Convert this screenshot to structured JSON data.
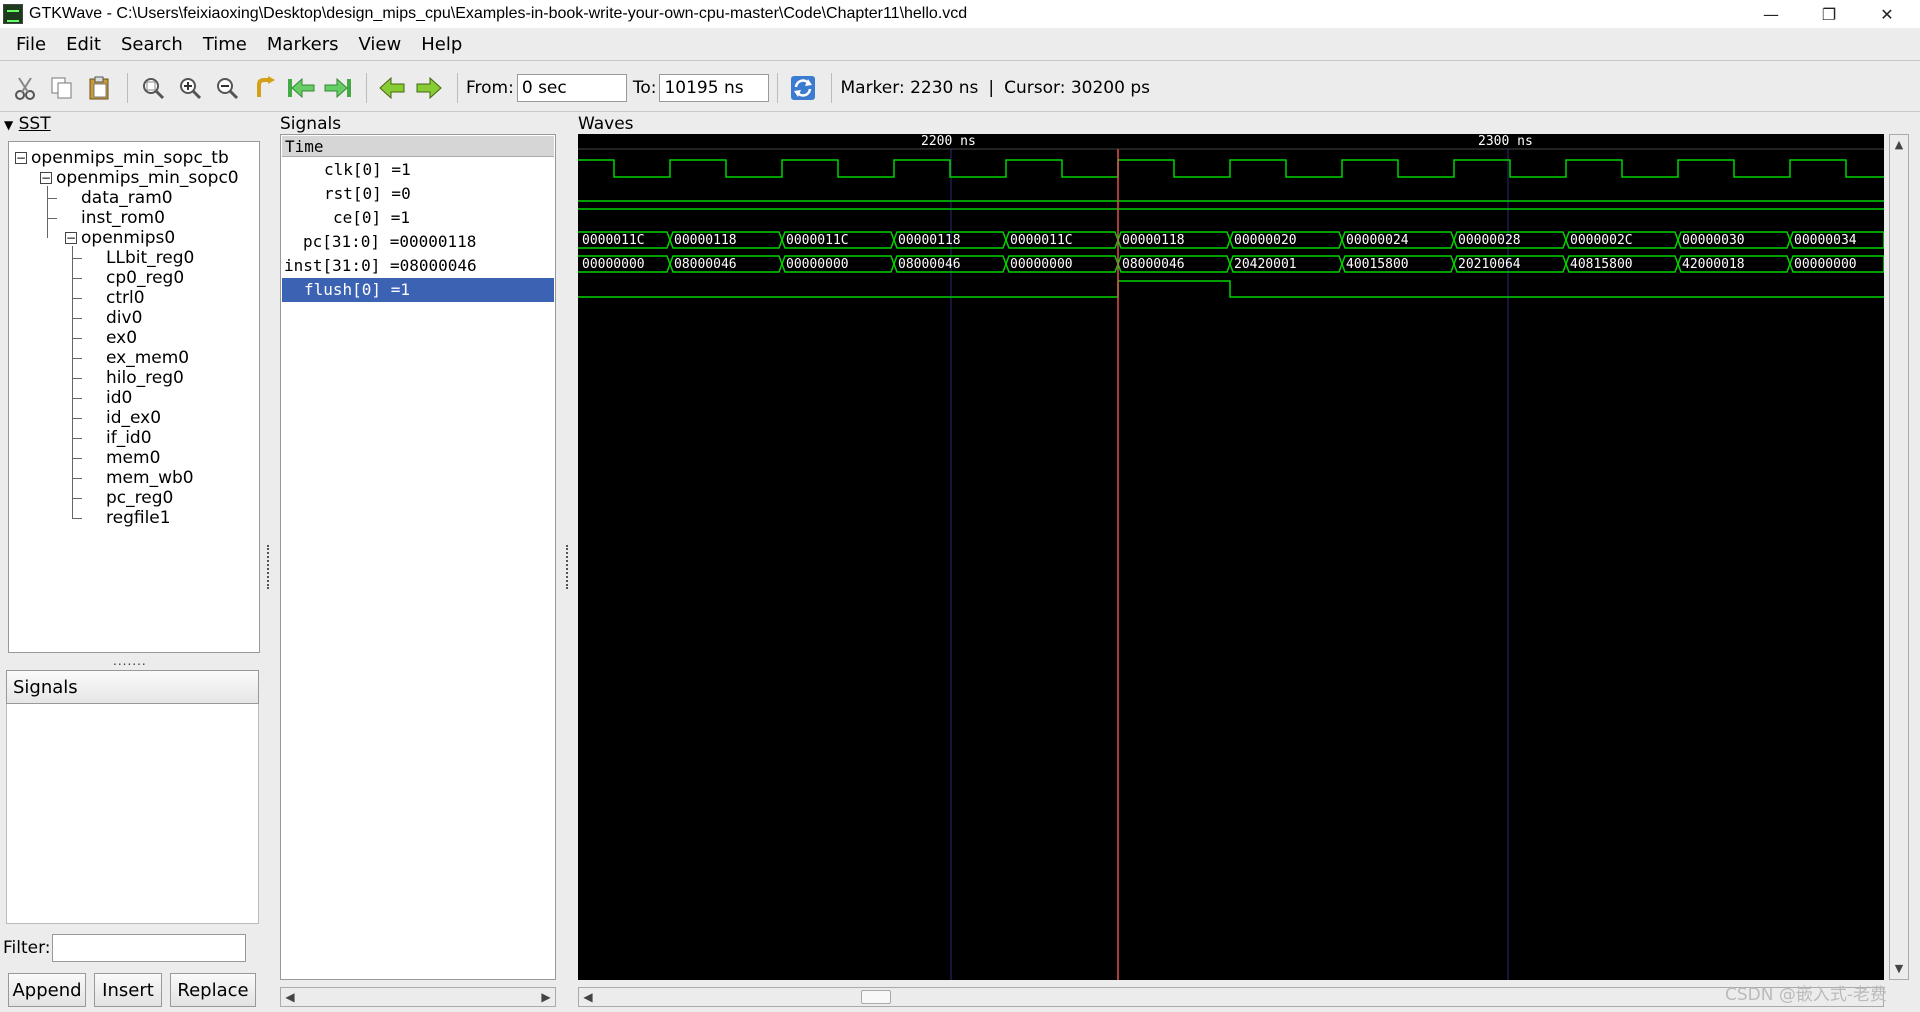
{
  "window": {
    "title": "GTKWave - C:\\Users\\feixiaoxing\\Desktop\\design_mips_cpu\\Examples-in-book-write-your-own-cpu-master\\Code\\Chapter11\\hello.vcd",
    "minimize_glyph": "—",
    "restore_glyph": "❐",
    "close_glyph": "✕"
  },
  "menu": [
    "File",
    "Edit",
    "Search",
    "Time",
    "Markers",
    "View",
    "Help"
  ],
  "toolbar": {
    "icons": [
      "cut-icon",
      "copy-icon",
      "paste-icon",
      "zoom-fit-icon",
      "zoom-in-icon",
      "zoom-out-icon",
      "zoom-undo-icon",
      "jump-start-icon",
      "jump-end-icon",
      "prev-edge-icon",
      "next-edge-icon",
      "reload-icon"
    ],
    "from_label": "From:",
    "from_value": "0 sec",
    "to_label": "To:",
    "to_value": "10195 ns",
    "marker_text": "Marker: 2230 ns",
    "separator": "|",
    "cursor_text": "Cursor: 30200 ps"
  },
  "sst": {
    "title": "SST",
    "tree": [
      {
        "label": "openmips_min_sopc_tb",
        "level": 0,
        "expanded": true
      },
      {
        "label": "openmips_min_sopc0",
        "level": 1,
        "expanded": true
      },
      {
        "label": "data_ram0",
        "level": 2
      },
      {
        "label": "inst_rom0",
        "level": 2
      },
      {
        "label": "openmips0",
        "level": 2,
        "expanded": true
      },
      {
        "label": "LLbit_reg0",
        "level": 3
      },
      {
        "label": "cp0_reg0",
        "level": 3
      },
      {
        "label": "ctrl0",
        "level": 3
      },
      {
        "label": "div0",
        "level": 3
      },
      {
        "label": "ex0",
        "level": 3
      },
      {
        "label": "ex_mem0",
        "level": 3
      },
      {
        "label": "hilo_reg0",
        "level": 3
      },
      {
        "label": "id0",
        "level": 3
      },
      {
        "label": "id_ex0",
        "level": 3
      },
      {
        "label": "if_id0",
        "level": 3
      },
      {
        "label": "mem0",
        "level": 3
      },
      {
        "label": "mem_wb0",
        "level": 3
      },
      {
        "label": "pc_reg0",
        "level": 3
      },
      {
        "label": "regfile1",
        "level": 3
      }
    ],
    "signals_header": "Signals",
    "filter_label": "Filter:",
    "filter_value": "",
    "buttons": {
      "append": "Append",
      "insert": "Insert",
      "replace": "Replace"
    }
  },
  "signals": {
    "title": "Signals",
    "header": "Time",
    "rows": [
      {
        "text": "clk[0] =1",
        "selected": false
      },
      {
        "text": "rst[0] =0",
        "selected": false
      },
      {
        "text": "ce[0] =1",
        "selected": false
      },
      {
        "text": "pc[31:0] =00000118",
        "selected": false
      },
      {
        "text": "inst[31:0] =08000046",
        "selected": false
      },
      {
        "text": "flush[0] =1",
        "selected": true
      }
    ]
  },
  "waves": {
    "title": "Waves",
    "time_labels": [
      "2200 ns",
      "2300 ns"
    ],
    "colors": {
      "trace": "#00d200",
      "marker": "#e05050",
      "grid": "#2a2a7a",
      "text": "#ffffff",
      "background": "#000000"
    },
    "pc_values": [
      "0000011C",
      "00000118",
      "0000011C",
      "00000118",
      "0000011C",
      "00000118",
      "00000020",
      "00000024",
      "00000028",
      "0000002C",
      "00000030",
      "00000034"
    ],
    "inst_values": [
      "00000000",
      "08000046",
      "00000000",
      "08000046",
      "00000000",
      "08000046",
      "20420001",
      "40015800",
      "20210064",
      "40815800",
      "42000018",
      "00000000"
    ]
  },
  "watermark": "CSDN @嵌入式-老费"
}
